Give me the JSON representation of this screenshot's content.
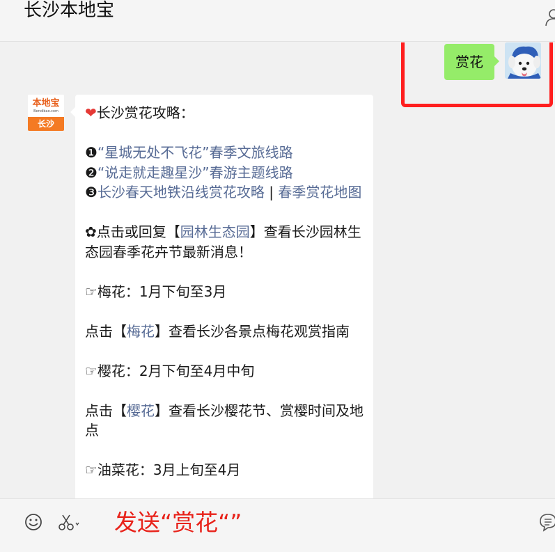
{
  "header": {
    "title": "长沙本地宝"
  },
  "outgoing": {
    "text": "赏花"
  },
  "sender": {
    "logo_name": "本地宝",
    "logo_url": "Bendibao.com",
    "logo_city": "长沙"
  },
  "message": {
    "heart": "❤",
    "title": "长沙赏花攻略：",
    "items": [
      {
        "bullet": "❶",
        "link": "“星城无处不飞花”春季文旅线路"
      },
      {
        "bullet": "❷",
        "link": "“说走就走趣星沙”春游主题线路"
      },
      {
        "bullet": "❸",
        "link": "长沙春天地铁沿线赏花攻略",
        "sep": " | ",
        "link2": "春季赏花地图"
      }
    ],
    "garden": {
      "pre": "✿点击或回复【",
      "link": "园林生态园",
      "post": "】查看长沙园林生态园春季花卉节最新消息！"
    },
    "plum": {
      "season": "☞梅花：1月下旬至3月",
      "pre": "点击【",
      "link": "梅花",
      "post": "】查看长沙各景点梅花观赏指南"
    },
    "cherry": {
      "season": "☞樱花：2月下旬至4月中旬",
      "pre": "点击【",
      "link": "樱花",
      "post": "】查看长沙樱花节、赏樱时间及地点"
    },
    "rapeseed": {
      "season": "☞油菜花：3月上旬至4月"
    }
  },
  "toolbar": {
    "instruction": "发送“赏花“”"
  },
  "icons": {
    "emoji": "emoji-icon",
    "scissors": "scissors-icon",
    "profile": "profile-icon",
    "chat": "chat-bubble-icon"
  },
  "colors": {
    "outgoing_bubble": "#95ec69",
    "link": "#576b95",
    "highlight": "#ff1e1e",
    "instruction": "#e8221a",
    "logo_orange": "#f47a23"
  }
}
